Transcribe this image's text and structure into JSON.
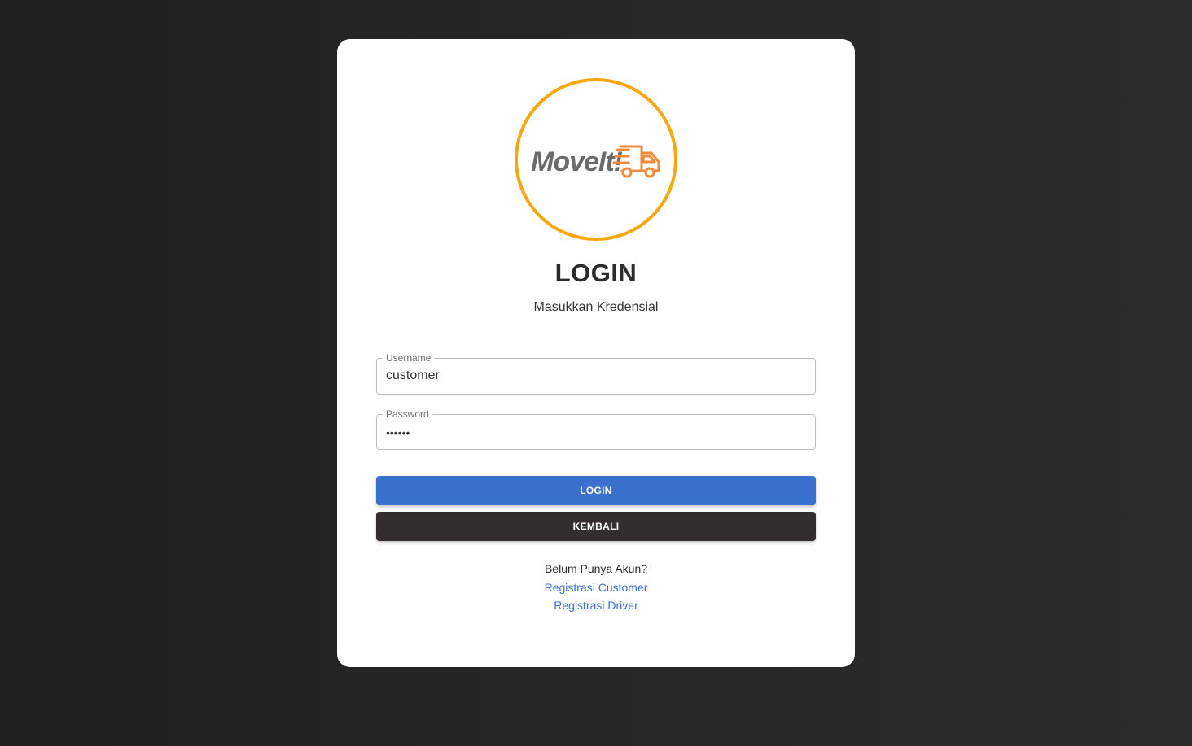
{
  "logo": {
    "brand_text": "MoveIt!",
    "icon": "truck-icon",
    "colors": {
      "ring": "#f7a80c",
      "text": "#6b6b6b",
      "truck": "#f08a3c"
    }
  },
  "header": {
    "title": "LOGIN",
    "subtitle": "Masukkan Kredensial"
  },
  "form": {
    "username": {
      "label": "Username",
      "value": "customer"
    },
    "password": {
      "label": "Password",
      "value": "••••••"
    },
    "login_button": "LOGIN",
    "back_button": "KEMBALI"
  },
  "footer": {
    "question": "Belum Punya Akun?",
    "register_customer": "Registrasi Customer",
    "register_driver": "Registrasi Driver"
  },
  "colors": {
    "primary": "#3b71ce",
    "dark": "#332d2d"
  }
}
